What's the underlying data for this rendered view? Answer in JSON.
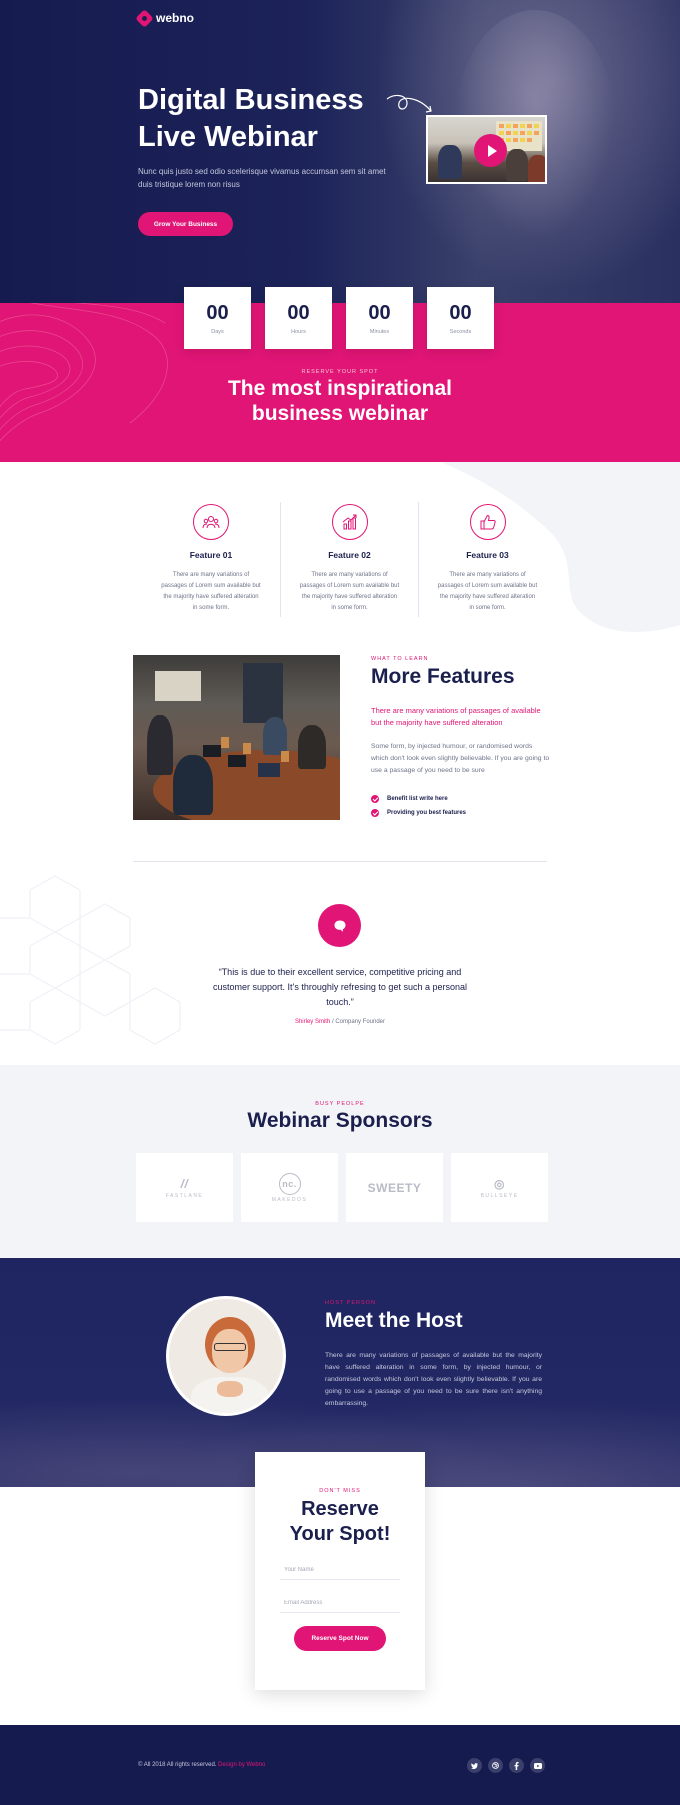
{
  "brand": {
    "name": "webno"
  },
  "hero": {
    "title_line1": "Digital Business",
    "title_line2": "Live Webinar",
    "subtitle": "Nunc quis justo sed odio scelerisque vivamus accumsan sem sit amet duis tristique lorem non risus",
    "cta_label": "Grow Your Business"
  },
  "countdown": [
    {
      "value": "00",
      "label": "Days"
    },
    {
      "value": "00",
      "label": "Hours"
    },
    {
      "value": "00",
      "label": "Minutes"
    },
    {
      "value": "00",
      "label": "Seconds"
    }
  ],
  "reserve_band": {
    "label": "RESERVE YOUR SPOT",
    "title_line1": "The most inspirational",
    "title_line2": "business webinar"
  },
  "features": [
    {
      "icon": "people-icon",
      "title": "Feature 01",
      "text": "There are many variations of passages of Lorem sum available but the majority have suffered alteration in some form."
    },
    {
      "icon": "chart-icon",
      "title": "Feature 02",
      "text": "There are many variations of passages of Lorem sum available but the majority have suffered alteration in some form."
    },
    {
      "icon": "thumbs-up-icon",
      "title": "Feature 03",
      "text": "There are many variations of passages of Lorem sum available but the majority have suffered alteration in some form."
    }
  ],
  "more_features": {
    "label": "WHAT TO LEARN",
    "title": "More Features",
    "lead": "There are many variations of passages of available but the majority have suffered alteration",
    "body": "Some form, by injected humour, or randomised words which don't look even slightly believable. If you are going to use a passage of you need to be sure",
    "list": [
      "Benefit list write here",
      "Providing you best features"
    ]
  },
  "testimonial": {
    "quote": "“This is due to their excellent service, competitive pricing and customer support. It’s throughly refresing to get such a personal touch.”",
    "author": "Shirley Smith",
    "role": " / Company Founder"
  },
  "sponsors": {
    "label": "BUSY PEOLPE",
    "title": "Webinar Sponsors",
    "items": [
      {
        "name": "FASTLANE",
        "mark": "//"
      },
      {
        "name": "MAKEDOS",
        "mark": "nc."
      },
      {
        "name": "SWEETY",
        "mark": "SWEETY"
      },
      {
        "name": "BULLSEYE",
        "mark": "◎"
      }
    ]
  },
  "host": {
    "label": "HOST PERSON",
    "title": "Meet the Host",
    "text": "There are many variations of passages of available but the majority have suffered alteration in some form, by injected humour, or randomised words which don't look even slightly believable. If you are going to use a passage of you need to be sure there isn't anything embarrassing."
  },
  "reserve_form": {
    "label": "DON'T MISS",
    "title_line1": "Reserve",
    "title_line2": "Your Spot!",
    "name_placeholder": "Your Name",
    "email_placeholder": "Email Address",
    "button_label": "Reserve Spot Now"
  },
  "footer": {
    "copyright": "© All 2018 All rights reserved. ",
    "credit": "Design by Webno",
    "social": [
      "twitter-icon",
      "dribbble-icon",
      "facebook-icon",
      "youtube-icon"
    ]
  },
  "colors": {
    "primary": "#e01575",
    "navy": "#161b4f",
    "text": "#1b1f4d"
  }
}
